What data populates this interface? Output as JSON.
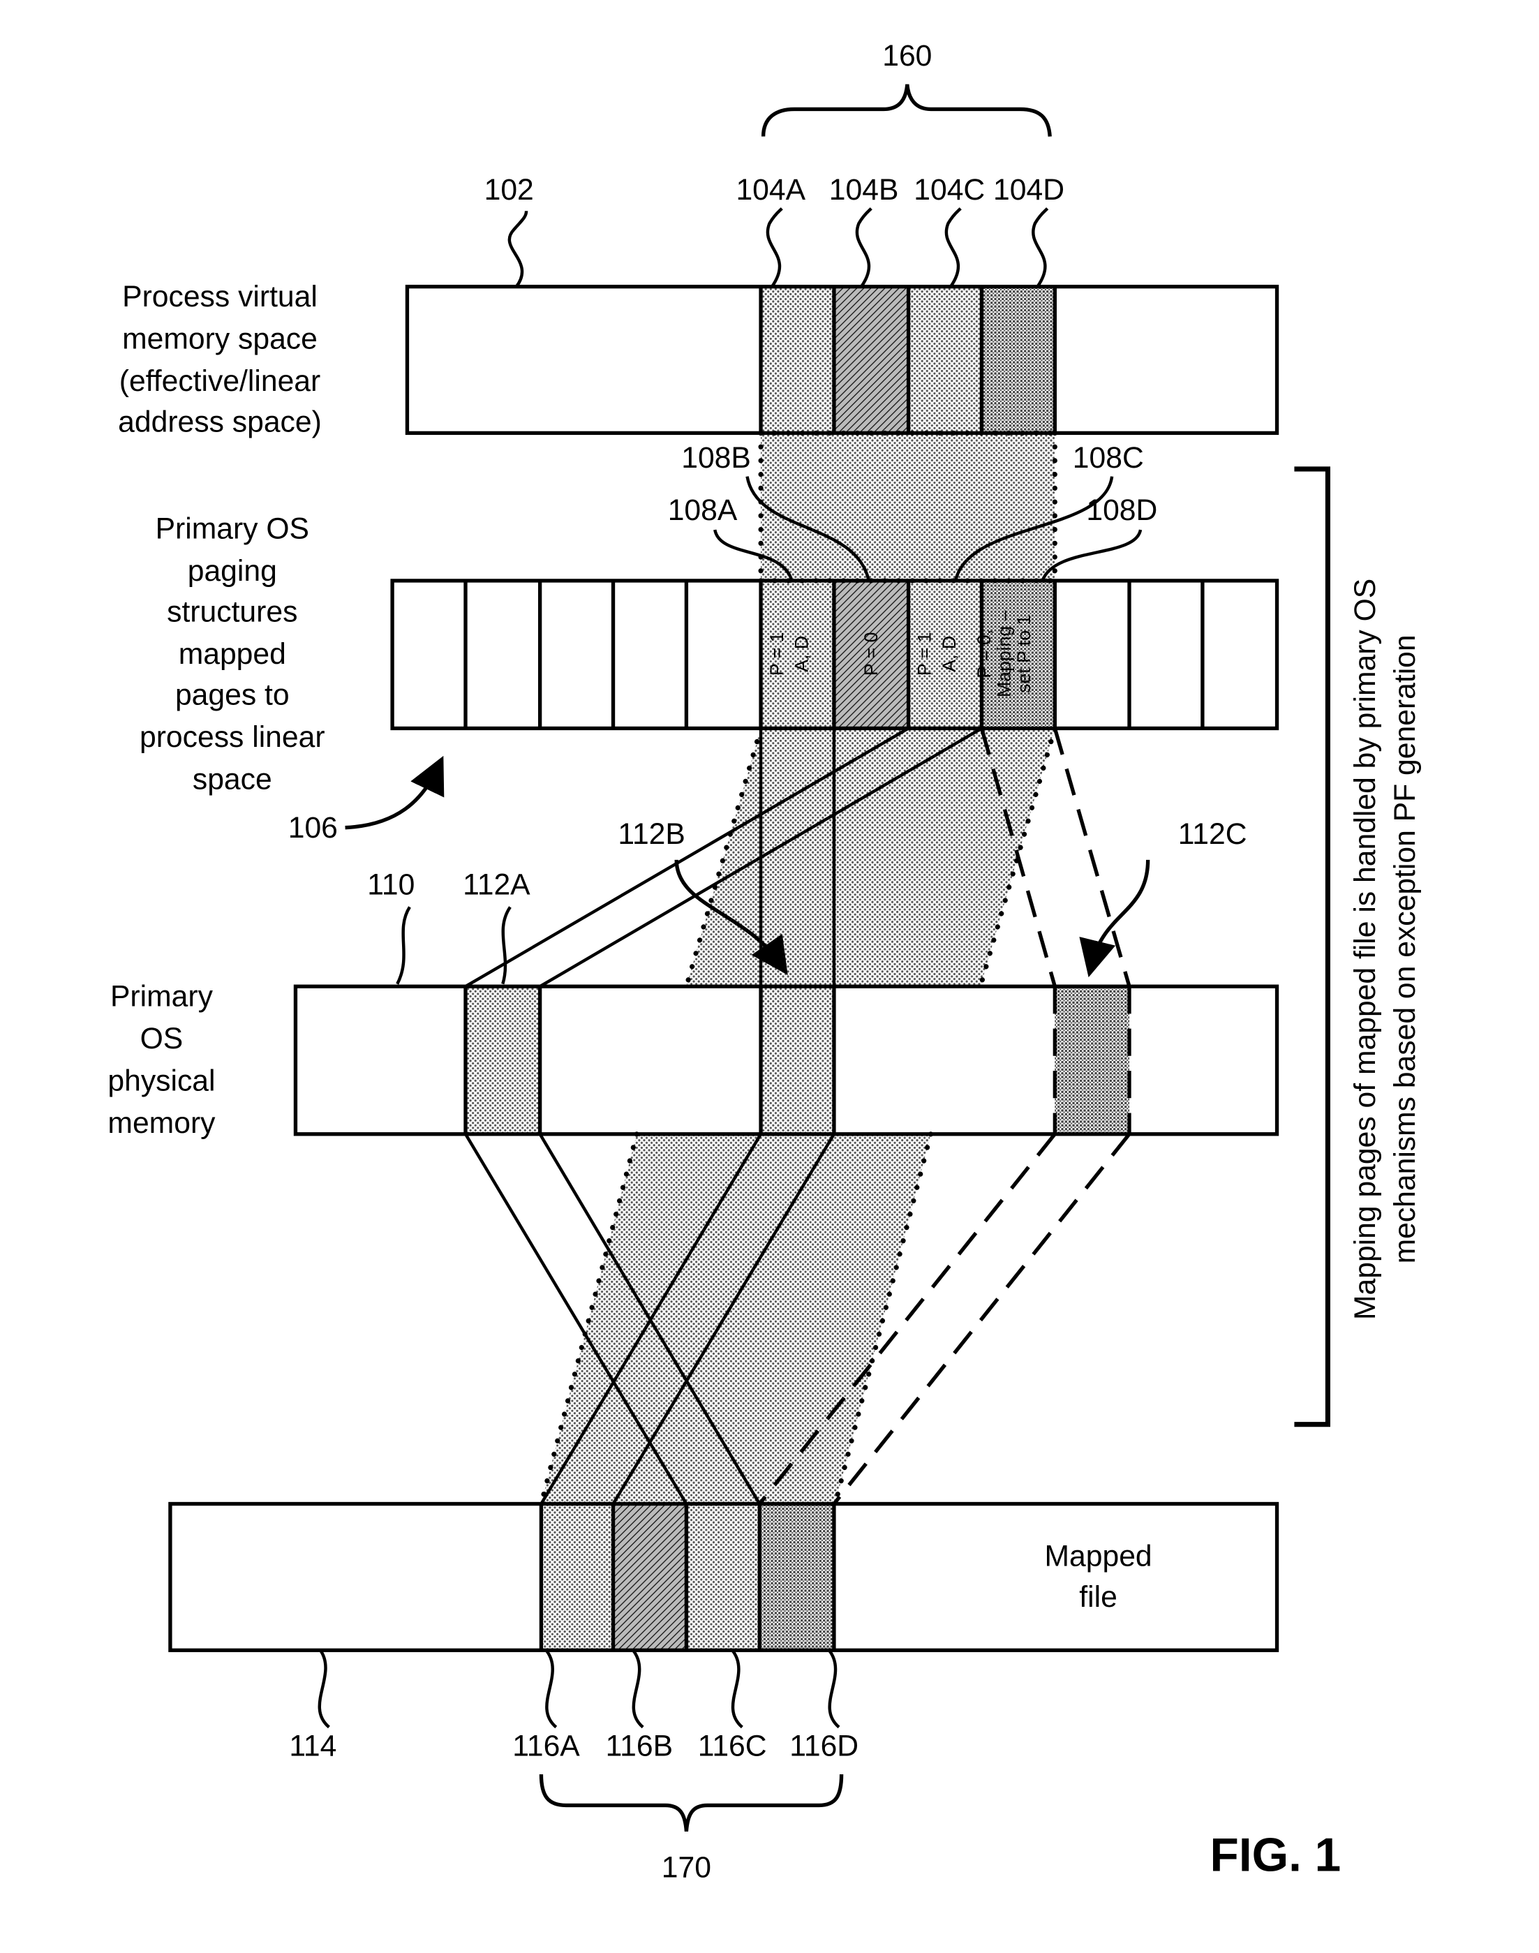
{
  "figure": {
    "title": "FIG. 1",
    "bracket_top_label": "160",
    "bracket_bottom_label": "170",
    "side_note": [
      "Mapping pages of mapped file is handled by primary OS",
      "mechanisms based on exception PF generation"
    ]
  },
  "rows": {
    "virtual": {
      "ref": "102",
      "label_lines": [
        "Process virtual",
        "memory space",
        "(effective/linear",
        "address space)"
      ],
      "pages": [
        "104A",
        "104B",
        "104C",
        "104D"
      ]
    },
    "paging": {
      "ref": "106",
      "label_lines": [
        "Primary OS",
        "paging",
        "structures",
        "mapped",
        "pages to",
        "process linear",
        "space"
      ],
      "entries": [
        {
          "line1": "P = 1",
          "line2": "A, D"
        },
        {
          "line1": "P = 0",
          "line2": ""
        },
        {
          "line1": "P = 1",
          "line2": "A, D"
        },
        {
          "line1": "P = 0,",
          "line2": "Mapping –",
          "line3": "set P to 1"
        }
      ],
      "links": [
        "108A",
        "108B",
        "108C",
        "108D"
      ]
    },
    "physical": {
      "ref": "110",
      "label_lines": [
        "Primary",
        "OS",
        "physical",
        "memory"
      ],
      "frames": [
        "112A",
        "112B",
        "112C"
      ]
    },
    "file": {
      "ref": "114",
      "label_lines": [
        "Mapped",
        "file"
      ],
      "pages": [
        "116A",
        "116B",
        "116C",
        "116D"
      ]
    }
  },
  "colors": {
    "ink": "#000000",
    "shade_light": "#d9d9d9",
    "shade_dark": "#a6a6a6"
  }
}
